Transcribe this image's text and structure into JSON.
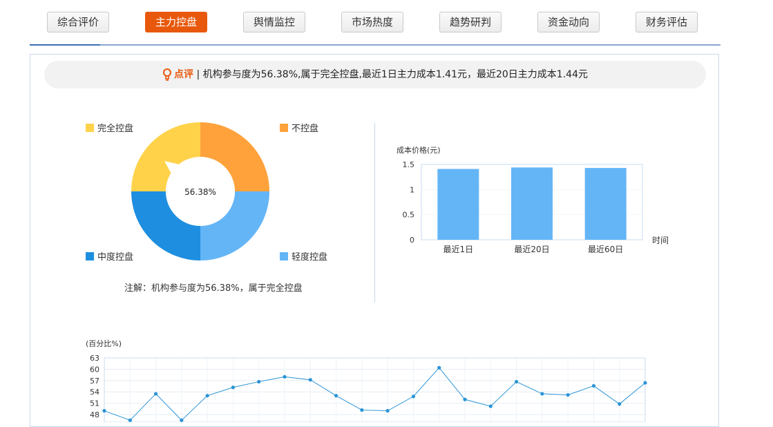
{
  "tabs": [
    {
      "label": "综合评价",
      "active": false
    },
    {
      "label": "主力控盘",
      "active": true
    },
    {
      "label": "舆情监控",
      "active": false
    },
    {
      "label": "市场热度",
      "active": false
    },
    {
      "label": "趋势研判",
      "active": false
    },
    {
      "label": "资金动向",
      "active": false
    },
    {
      "label": "财务评估",
      "active": false
    }
  ],
  "remark": {
    "tag": "点评",
    "separator": "|",
    "text": "机构参与度为56.38%,属于完全控盘,最近1日主力成本1.41元，最近20日主力成本1.44元"
  },
  "colors": {
    "accent": "#e8580c",
    "full_control": "#ffd24a",
    "no_control": "#ffa23c",
    "medium_control": "#1e8fe0",
    "light_control": "#64b5f6",
    "bar": "#64b5f6",
    "line": "#2a93d5"
  },
  "donut": {
    "center_label": "56.38%",
    "legend": [
      "完全控盘",
      "不控盘",
      "中度控盘",
      "轻度控盘"
    ],
    "note": "注解：机构参与度为56.38%，属于完全控盘"
  },
  "chart_data": [
    {
      "type": "pie",
      "variant": "donut",
      "categories": [
        "完全控盘",
        "不控盘",
        "轻度控盘",
        "中度控盘"
      ],
      "values": [
        25,
        25,
        25,
        25
      ],
      "pointer_value": 56.38,
      "center_label": "56.38%"
    },
    {
      "type": "bar",
      "categories": [
        "最近1日",
        "最近20日",
        "最近60日"
      ],
      "values": [
        1.41,
        1.44,
        1.43
      ],
      "ylabel": "成本价格(元)",
      "xlabel": "时间",
      "ylim": [
        0,
        1.5
      ],
      "yticks": [
        "0",
        "0.5",
        "1",
        "1.5"
      ],
      "grid": true
    },
    {
      "type": "line",
      "ylabel": "(百分比%)",
      "yticks": [
        "48",
        "51",
        "54",
        "57",
        "60",
        "63"
      ],
      "ylim": [
        48,
        63
      ],
      "values": [
        49,
        46.5,
        53.5,
        46.5,
        53,
        55.2,
        56.7,
        58,
        57.2,
        53,
        49.2,
        49,
        52.8,
        60.4,
        52,
        50.2,
        56.7,
        53.5,
        53.2,
        55.6,
        50.8,
        56.4
      ],
      "grid": true
    }
  ]
}
